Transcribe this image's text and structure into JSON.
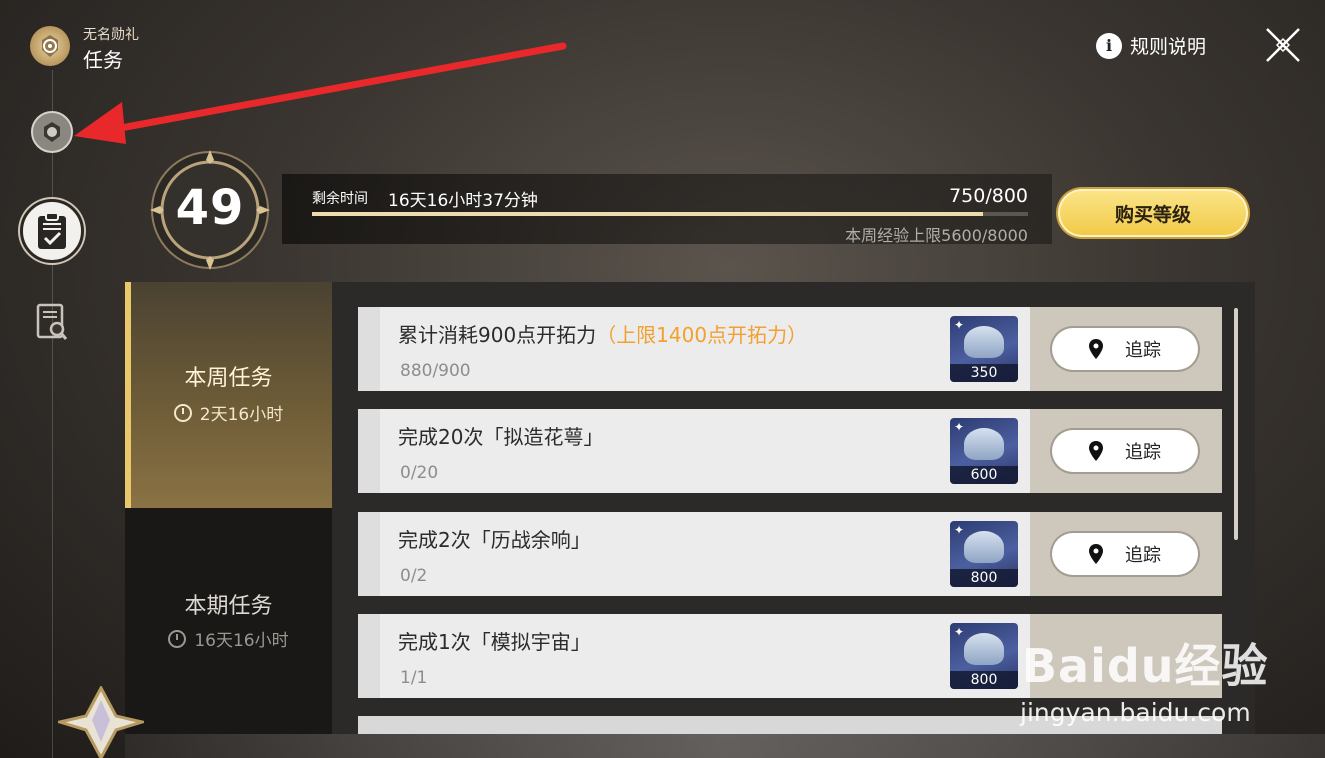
{
  "header": {
    "subtitle": "无名勋礼",
    "title": "任务",
    "help_label": "规则说明"
  },
  "level": {
    "value": "49",
    "remaining_label": "剩余时间",
    "remaining_value": "16天16小时37分钟",
    "exp": "750/800",
    "exp_fraction": 0.9375,
    "weekly_cap": "本周经验上限5600/8000",
    "buy_label": "购买等级"
  },
  "tabs": [
    {
      "label": "本周任务",
      "time": "2天16小时"
    },
    {
      "label": "本期任务",
      "time": "16天16小时"
    }
  ],
  "tasks": [
    {
      "title": "累计消耗900点开拓力",
      "limit": "（上限1400点开拓力）",
      "progress": "880/900",
      "reward": "350",
      "action": "追踪"
    },
    {
      "title": "完成20次「拟造花萼」",
      "limit": "",
      "progress": "0/20",
      "reward": "600",
      "action": "追踪"
    },
    {
      "title": "完成2次「历战余响」",
      "limit": "",
      "progress": "0/2",
      "reward": "800",
      "action": "追踪"
    },
    {
      "title": "完成1次「模拟宇宙」",
      "limit": "",
      "progress": "1/1",
      "reward": "800",
      "action": ""
    }
  ],
  "watermark": {
    "logo": "Baidu经验",
    "url": "jingyan.baidu.com"
  },
  "colors": {
    "accent_gold": "#f1c945",
    "limit_orange": "#f2a030",
    "arrow_red": "#e8282a"
  }
}
